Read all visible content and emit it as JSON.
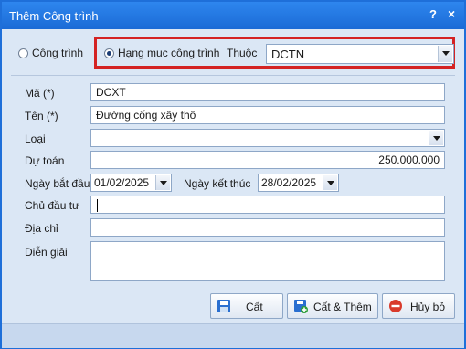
{
  "window": {
    "title": "Thêm Công trình",
    "help_label": "?",
    "close_label": "×"
  },
  "type_select": {
    "option_cong_trinh": "Công trình",
    "option_hang_muc": "Hạng mục công trình",
    "selected": "Hạng mục công trình",
    "thuoc_label": "Thuộc",
    "thuoc_value": "DCTN"
  },
  "form": {
    "ma_label": "Mã (*)",
    "ma_value": "DCXT",
    "ten_label": "Tên (*)",
    "ten_value": "Đường cống xây thô",
    "loai_label": "Loại",
    "loai_value": "",
    "du_toan_label": "Dự toán",
    "du_toan_value": "250.000.000",
    "ngay_bat_dau_label": "Ngày bắt đầu",
    "ngay_bat_dau_value": "01/02/2025",
    "ngay_ket_thuc_label": "Ngày kết thúc",
    "ngay_ket_thuc_value": "28/02/2025",
    "chu_dau_tu_label": "Chủ đầu tư",
    "chu_dau_tu_value": "",
    "dia_chi_label": "Địa chỉ",
    "dia_chi_value": "",
    "dien_giai_label": "Diễn giải",
    "dien_giai_value": ""
  },
  "buttons": {
    "save": "Cất",
    "save_add": "Cất & Thêm",
    "cancel": "Hủy bỏ"
  },
  "colors": {
    "highlight_border": "#d42323",
    "title_bar": "#1b6bd6"
  }
}
